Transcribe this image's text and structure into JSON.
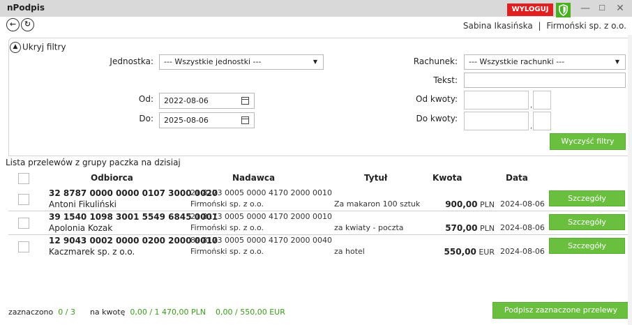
{
  "app": {
    "title": "nPodpis",
    "logout_label": "WYLOGUJ",
    "user_name": "Sabina Ikasińska",
    "company": "Firmoński sp. z o.o.",
    "separator": "|"
  },
  "window": {
    "minimize": "—",
    "maximize": "☐",
    "close": "✕"
  },
  "filters": {
    "toggle_label": "Ukryj filtry",
    "unit_label": "Jednostka:",
    "unit_value": "--- Wszystkie jednostki ---",
    "from_label": "Od:",
    "from_value": "2022-08-06",
    "to_label": "Do:",
    "to_value": "2025-08-06",
    "account_label": "Rachunek:",
    "account_value": "--- Wszystkie rachunki ---",
    "text_label": "Tekst:",
    "amount_from_label": "Od kwoty:",
    "amount_to_label": "Do kwoty:",
    "comma": ",",
    "clear_label": "Wyczyść filtry"
  },
  "list": {
    "title": "Lista przelewów z grupy paczka na dzisiaj",
    "columns": {
      "recipient": "Odbiorca",
      "sender": "Nadawca",
      "title": "Tytuł",
      "amount": "Kwota",
      "date": "Data"
    },
    "rows": [
      {
        "recipient_account": "32 8787 0000 0000 0107 3000 0020",
        "recipient_name": "Antoni Fikuliński",
        "sender_account": "21 8173 0005 0000 4170 2000 0010",
        "sender_name": "Firmoński sp. z o.o.",
        "title": "Za makaron 100 sztuk",
        "amount": "900,00",
        "currency": "PLN",
        "date": "2024-08-06",
        "details_label": "Szczegóły"
      },
      {
        "recipient_account": "39 1540 1098 3001 5549 6845 0001",
        "recipient_name": "Apolonia Kozak",
        "sender_account": "21 8173 0005 0000 4170 2000 0010",
        "sender_name": "Firmoński sp. z o.o.",
        "title": "za kwiaty - poczta",
        "amount": "570,00",
        "currency": "PLN",
        "date": "2024-08-06",
        "details_label": "Szczegóły"
      },
      {
        "recipient_account": "12 9043 0002 0000 0200 2000 0010",
        "recipient_name": "Kaczmarek sp. z o.o.",
        "sender_account": "84 8173 0005 0000 4170 2000 0040",
        "sender_name": "Firmoński sp. z o.o.",
        "title": "za hotel",
        "amount": "550,00",
        "currency": "EUR",
        "date": "2024-08-06",
        "details_label": "Szczegóły"
      }
    ]
  },
  "footer": {
    "selected_label": "zaznaczono",
    "selected_value": "0 / 3",
    "amount_label": "na kwotę",
    "pln_value": "0,00 / 1 470,00 PLN",
    "eur_value": "0,00 / 550,00 EUR",
    "sign_label": "Podpisz zaznaczone przelewy"
  },
  "colors": {
    "accent_green": "#6abf3f",
    "logout_red": "#e02020",
    "status_green": "#3a9a1c"
  }
}
